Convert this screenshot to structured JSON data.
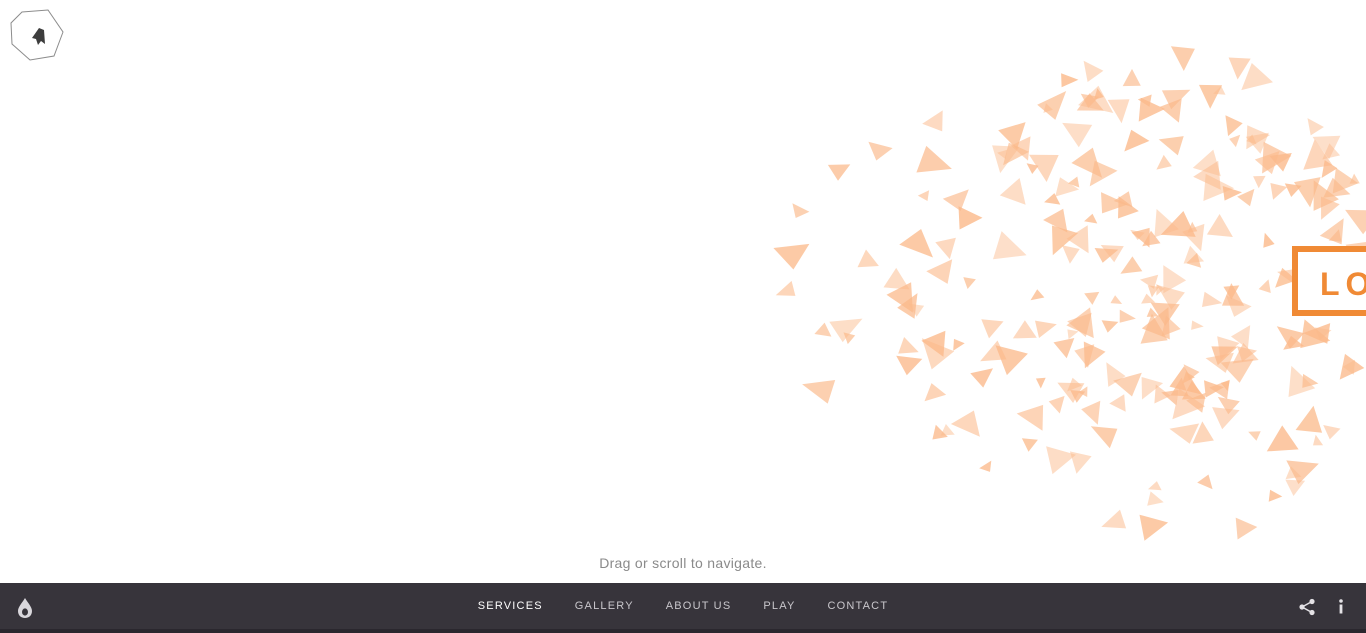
{
  "header": {
    "logo_icon": "studio-logo-icon"
  },
  "hero": {
    "box_label": "LO",
    "accent_color": "#f08a35",
    "particle_color": "#fbb98a",
    "hint": "Drag or scroll to navigate."
  },
  "footer": {
    "logo_icon": "drop-logo-icon",
    "nav": [
      {
        "label": "SERVICES",
        "active": true
      },
      {
        "label": "GALLERY",
        "active": false
      },
      {
        "label": "ABOUT US",
        "active": false
      },
      {
        "label": "PLAY",
        "active": false
      },
      {
        "label": "CONTACT",
        "active": false
      }
    ],
    "share_icon": "share-icon",
    "info_icon": "info-icon",
    "background": "#37343b"
  }
}
